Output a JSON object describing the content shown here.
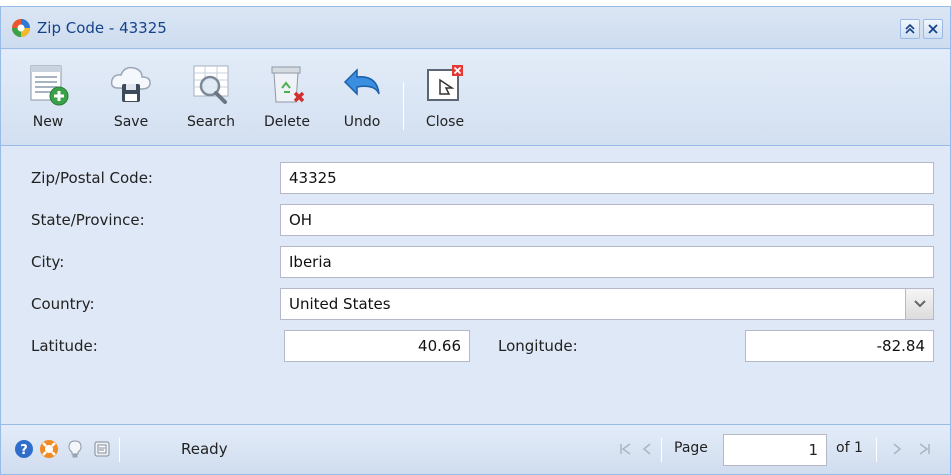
{
  "window": {
    "title": "Zip Code - 43325"
  },
  "toolbar": {
    "buttons": [
      {
        "label": "New",
        "icon": "new-record-icon"
      },
      {
        "label": "Save",
        "icon": "cloud-save-icon"
      },
      {
        "label": "Search",
        "icon": "search-grid-icon"
      },
      {
        "label": "Delete",
        "icon": "delete-bin-icon"
      },
      {
        "label": "Undo",
        "icon": "undo-arrow-icon"
      },
      {
        "label": "Close",
        "icon": "close-window-icon"
      }
    ]
  },
  "form": {
    "zip_label": "Zip/Postal Code:",
    "zip_value": "43325",
    "state_label": "State/Province:",
    "state_value": "OH",
    "city_label": "City:",
    "city_value": "Iberia",
    "country_label": "Country:",
    "country_value": "United States",
    "latitude_label": "Latitude:",
    "latitude_value": "40.66",
    "longitude_label": "Longitude:",
    "longitude_value": "-82.84"
  },
  "statusbar": {
    "status": "Ready",
    "page_label": "Page",
    "page_value": "1",
    "of_label": "of 1"
  },
  "colors": {
    "border": "#99bbe8",
    "title_text": "#15428b",
    "panel_bg": "#dfe8f6"
  }
}
